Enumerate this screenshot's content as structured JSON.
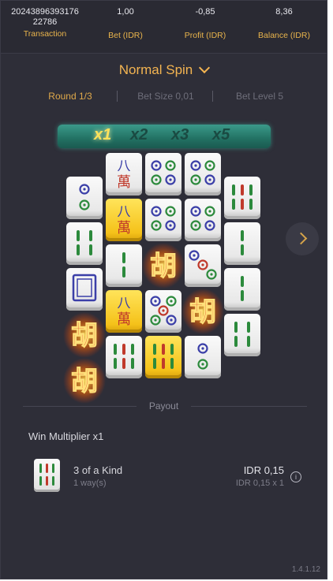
{
  "stats": {
    "transaction_id_line1": "20243896393176",
    "transaction_id_line2": "22786",
    "transaction_label": "Transaction",
    "bet_value": "1,00",
    "bet_label": "Bet (IDR)",
    "profit_value": "-0,85",
    "profit_label": "Profit (IDR)",
    "balance_value": "8,36",
    "balance_label": "Balance (IDR)"
  },
  "mode": {
    "label": "Normal Spin"
  },
  "info": {
    "round": "Round 1/3",
    "bet_size": "Bet Size 0,01",
    "bet_level": "Bet Level 5"
  },
  "multipliers": [
    "x1",
    "x2",
    "x3",
    "x5"
  ],
  "colors": {
    "accent": "#f3b451",
    "background": "#2e2e38",
    "banner": "#227163"
  },
  "reels": [
    [
      "dot2",
      "bamboo4",
      "blank-frame",
      "hu",
      "hu"
    ],
    [
      "wan8",
      "wan8-gold",
      "bamboo2",
      "wan8-gold",
      "bamboo6"
    ],
    [
      "dot4",
      "dot4",
      "hu",
      "dot5",
      "bamboo6-gold"
    ],
    [
      "dot4",
      "dot4",
      "dot3",
      "hu",
      "dot2"
    ],
    [
      "bamboo6",
      "bamboo2",
      "bamboo2",
      "bamboo4"
    ]
  ],
  "payout": {
    "section_label": "Payout",
    "win_multiplier": "Win Multiplier x1",
    "rows": [
      {
        "icon": "bamboo6",
        "title": "3 of a Kind",
        "ways": "1 way(s)",
        "amount": "IDR 0,15",
        "formula": "IDR 0,15 x 1"
      }
    ]
  },
  "version": "1.4.1.12"
}
